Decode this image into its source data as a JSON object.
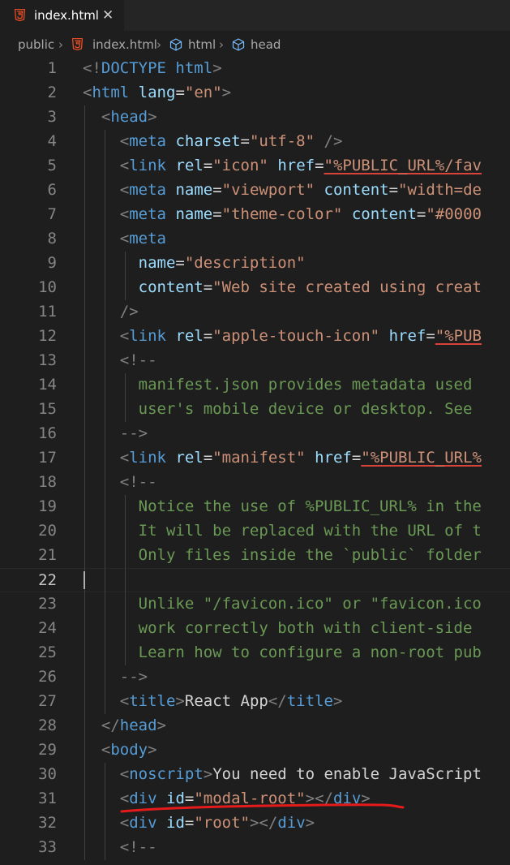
{
  "tab": {
    "label": "index.html",
    "close_glyph": "✕",
    "icon": "html5-icon"
  },
  "breadcrumb": [
    "public",
    "index.html",
    "html",
    "head"
  ],
  "colors": {
    "tag": "#569cd6",
    "attr": "#9cdcfe",
    "string": "#ce9178",
    "comment": "#6a9955",
    "text": "#d4d4d4",
    "punct": "#808080",
    "annotation": "#e51b1b"
  },
  "editor": {
    "active_line": 22,
    "lines": [
      {
        "n": "1",
        "t": [
          [
            "p",
            "<!"
          ],
          [
            "k",
            "DOCTYPE"
          ],
          [
            "x",
            " "
          ],
          [
            "k",
            "html"
          ],
          [
            "p",
            ">"
          ]
        ]
      },
      {
        "n": "2",
        "t": [
          [
            "p",
            "<"
          ],
          [
            "g",
            "html"
          ],
          [
            "x",
            " "
          ],
          [
            "a",
            "lang"
          ],
          [
            "x",
            "="
          ],
          [
            "s",
            "\"en\""
          ],
          [
            "p",
            ">"
          ]
        ]
      },
      {
        "n": "3",
        "t": [
          [
            "x",
            "  "
          ],
          [
            "p",
            "<"
          ],
          [
            "g",
            "head"
          ],
          [
            "p",
            ">"
          ]
        ]
      },
      {
        "n": "4",
        "t": [
          [
            "x",
            "    "
          ],
          [
            "p",
            "<"
          ],
          [
            "g",
            "meta"
          ],
          [
            "x",
            " "
          ],
          [
            "a",
            "charset"
          ],
          [
            "x",
            "="
          ],
          [
            "s",
            "\"utf-8\""
          ],
          [
            "x",
            " "
          ],
          [
            "p",
            "/>"
          ]
        ]
      },
      {
        "n": "5",
        "t": [
          [
            "x",
            "    "
          ],
          [
            "p",
            "<"
          ],
          [
            "g",
            "link"
          ],
          [
            "x",
            " "
          ],
          [
            "a",
            "rel"
          ],
          [
            "x",
            "="
          ],
          [
            "s",
            "\"icon\""
          ],
          [
            "x",
            " "
          ],
          [
            "a",
            "href"
          ],
          [
            "x",
            "="
          ],
          [
            "u",
            "\"%PUBLIC_URL%/fav"
          ]
        ]
      },
      {
        "n": "6",
        "t": [
          [
            "x",
            "    "
          ],
          [
            "p",
            "<"
          ],
          [
            "g",
            "meta"
          ],
          [
            "x",
            " "
          ],
          [
            "a",
            "name"
          ],
          [
            "x",
            "="
          ],
          [
            "s",
            "\"viewport\""
          ],
          [
            "x",
            " "
          ],
          [
            "a",
            "content"
          ],
          [
            "x",
            "="
          ],
          [
            "s",
            "\"width=de"
          ]
        ]
      },
      {
        "n": "7",
        "t": [
          [
            "x",
            "    "
          ],
          [
            "p",
            "<"
          ],
          [
            "g",
            "meta"
          ],
          [
            "x",
            " "
          ],
          [
            "a",
            "name"
          ],
          [
            "x",
            "="
          ],
          [
            "s",
            "\"theme-color\""
          ],
          [
            "x",
            " "
          ],
          [
            "a",
            "content"
          ],
          [
            "x",
            "="
          ],
          [
            "s",
            "\"#0000"
          ]
        ]
      },
      {
        "n": "8",
        "t": [
          [
            "x",
            "    "
          ],
          [
            "p",
            "<"
          ],
          [
            "g",
            "meta"
          ]
        ]
      },
      {
        "n": "9",
        "t": [
          [
            "x",
            "      "
          ],
          [
            "a",
            "name"
          ],
          [
            "x",
            "="
          ],
          [
            "s",
            "\"description\""
          ]
        ]
      },
      {
        "n": "10",
        "t": [
          [
            "x",
            "      "
          ],
          [
            "a",
            "content"
          ],
          [
            "x",
            "="
          ],
          [
            "s",
            "\"Web site created using creat"
          ]
        ]
      },
      {
        "n": "11",
        "t": [
          [
            "x",
            "    "
          ],
          [
            "p",
            "/>"
          ]
        ]
      },
      {
        "n": "12",
        "t": [
          [
            "x",
            "    "
          ],
          [
            "p",
            "<"
          ],
          [
            "g",
            "link"
          ],
          [
            "x",
            " "
          ],
          [
            "a",
            "rel"
          ],
          [
            "x",
            "="
          ],
          [
            "s",
            "\"apple-touch-icon\""
          ],
          [
            "x",
            " "
          ],
          [
            "a",
            "href"
          ],
          [
            "x",
            "="
          ],
          [
            "u",
            "\"%PUB"
          ]
        ]
      },
      {
        "n": "13",
        "t": [
          [
            "x",
            "    "
          ],
          [
            "p",
            "<!--"
          ]
        ]
      },
      {
        "n": "14",
        "t": [
          [
            "c",
            "      manifest.json provides metadata used"
          ]
        ]
      },
      {
        "n": "15",
        "t": [
          [
            "c",
            "      user's mobile device or desktop. See"
          ]
        ]
      },
      {
        "n": "16",
        "t": [
          [
            "x",
            "    "
          ],
          [
            "p",
            "-->"
          ]
        ]
      },
      {
        "n": "17",
        "t": [
          [
            "x",
            "    "
          ],
          [
            "p",
            "<"
          ],
          [
            "g",
            "link"
          ],
          [
            "x",
            " "
          ],
          [
            "a",
            "rel"
          ],
          [
            "x",
            "="
          ],
          [
            "s",
            "\"manifest\""
          ],
          [
            "x",
            " "
          ],
          [
            "a",
            "href"
          ],
          [
            "x",
            "="
          ],
          [
            "u",
            "\"%PUBLIC_URL%"
          ]
        ]
      },
      {
        "n": "18",
        "t": [
          [
            "x",
            "    "
          ],
          [
            "p",
            "<!--"
          ]
        ]
      },
      {
        "n": "19",
        "t": [
          [
            "c",
            "      Notice the use of %PUBLIC_URL% in the"
          ]
        ]
      },
      {
        "n": "20",
        "t": [
          [
            "c",
            "      It will be replaced with the URL of t"
          ]
        ]
      },
      {
        "n": "21",
        "t": [
          [
            "c",
            "      Only files inside the `public` folder"
          ]
        ]
      },
      {
        "n": "22",
        "t": []
      },
      {
        "n": "23",
        "t": [
          [
            "c",
            "      Unlike \"/favicon.ico\" or \"favicon.ico"
          ]
        ]
      },
      {
        "n": "24",
        "t": [
          [
            "c",
            "      work correctly both with client-side"
          ]
        ]
      },
      {
        "n": "25",
        "t": [
          [
            "c",
            "      Learn how to configure a non-root pub"
          ]
        ]
      },
      {
        "n": "26",
        "t": [
          [
            "x",
            "    "
          ],
          [
            "p",
            "-->"
          ]
        ]
      },
      {
        "n": "27",
        "t": [
          [
            "x",
            "    "
          ],
          [
            "p",
            "<"
          ],
          [
            "g",
            "title"
          ],
          [
            "p",
            ">"
          ],
          [
            "x",
            "React App"
          ],
          [
            "p",
            "</"
          ],
          [
            "g",
            "title"
          ],
          [
            "p",
            ">"
          ]
        ]
      },
      {
        "n": "28",
        "t": [
          [
            "x",
            "  "
          ],
          [
            "p",
            "</"
          ],
          [
            "g",
            "head"
          ],
          [
            "p",
            ">"
          ]
        ]
      },
      {
        "n": "29",
        "t": [
          [
            "x",
            "  "
          ],
          [
            "p",
            "<"
          ],
          [
            "g",
            "body"
          ],
          [
            "p",
            ">"
          ]
        ]
      },
      {
        "n": "30",
        "t": [
          [
            "x",
            "    "
          ],
          [
            "p",
            "<"
          ],
          [
            "g",
            "noscript"
          ],
          [
            "p",
            ">"
          ],
          [
            "x",
            "You need to enable JavaScript"
          ]
        ]
      },
      {
        "n": "31",
        "t": [
          [
            "x",
            "    "
          ],
          [
            "p",
            "<"
          ],
          [
            "g",
            "div"
          ],
          [
            "x",
            " "
          ],
          [
            "a",
            "id"
          ],
          [
            "x",
            "="
          ],
          [
            "s",
            "\"modal-root\""
          ],
          [
            "p",
            "></"
          ],
          [
            "g",
            "div"
          ],
          [
            "p",
            ">"
          ]
        ]
      },
      {
        "n": "32",
        "t": [
          [
            "x",
            "    "
          ],
          [
            "p",
            "<"
          ],
          [
            "g",
            "div"
          ],
          [
            "x",
            " "
          ],
          [
            "a",
            "id"
          ],
          [
            "x",
            "="
          ],
          [
            "s",
            "\"root\""
          ],
          [
            "p",
            "></"
          ],
          [
            "g",
            "div"
          ],
          [
            "p",
            ">"
          ]
        ]
      },
      {
        "n": "33",
        "t": [
          [
            "x",
            "    "
          ],
          [
            "p",
            "<!--"
          ]
        ]
      }
    ]
  }
}
